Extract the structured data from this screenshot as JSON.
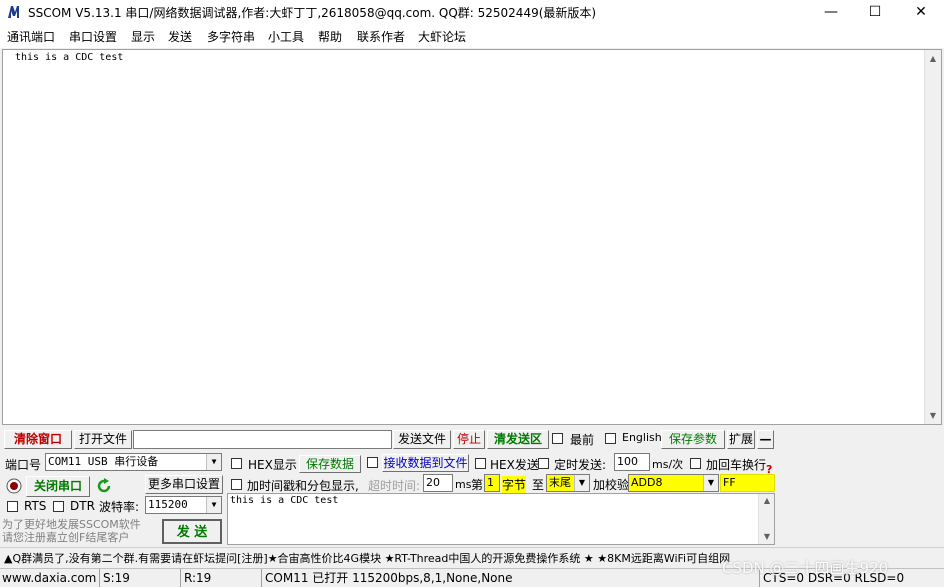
{
  "title": "SSCOM V5.13.1 串口/网络数据调试器,作者:大虾丁丁,2618058@qq.com. QQ群: 52502449(最新版本)",
  "window": {
    "minimize": "—",
    "maximize": "☐",
    "close": "✕"
  },
  "menu": [
    "通讯端口",
    "串口设置",
    "显示",
    "发送",
    "多字符串",
    "小工具",
    "帮助",
    "联系作者",
    "大虾论坛"
  ],
  "receive": {
    "text": "this is a CDC test"
  },
  "toolbar": {
    "clear_window": "清除窗口",
    "open_file": "打开文件",
    "file_path": "",
    "send_file": "发送文件",
    "stop": "停止",
    "clear_send": "清发送区",
    "topmost": "最前",
    "english": "English",
    "save_params": "保存参数",
    "expand": "扩展",
    "collapse": "—"
  },
  "port": {
    "label": "端口号",
    "value": "COM11 USB 串行设备",
    "close_port": "关闭串口",
    "more_settings": "更多串口设置",
    "rts": "RTS",
    "dtr": "DTR",
    "baud_label": "波特率:",
    "baud_value": "115200"
  },
  "options": {
    "hex_display": "HEX显示",
    "save_data": "保存数据",
    "recv_to_file": "接收数据到文件",
    "hex_send": "HEX发送",
    "timed_send": "定时发送:",
    "interval": "100",
    "interval_unit": "ms/次",
    "add_crlf": "加回车换行",
    "timestamp": "加时间戳和分包显示,",
    "timeout_label": "超时时间:",
    "timeout_value": "20",
    "timeout_unit": "ms",
    "nth_label": "第",
    "nth_value": "1",
    "byte_label": "字节",
    "to_label": "至",
    "end_value": "末尾",
    "checksum_label": "加校验",
    "checksum_value": "ADD8",
    "checksum_result": "FF",
    "help_mark": "?"
  },
  "send": {
    "text": "this is a CDC test",
    "button": "发 送",
    "promo": "为了更好地发展SSCOM软件\n请您注册嘉立创F结尾客户"
  },
  "ticker": "▲Q群满员了,没有第二个群.有需要请在虾坛提问[注册]★合宙高性价比4G模块 ★RT-Thread中国人的开源免费操作系统 ★ ★8KM远距离WiFi可自组网",
  "status": {
    "website": "www.daxia.com",
    "sent": "S:19",
    "received": "R:19",
    "port_status": "COM11 已打开  115200bps,8,1,None,None",
    "lines": "CTS=0 DSR=0 RLSD=0"
  },
  "watermark": "CSDN @二十四画生920",
  "colors": {
    "accent_red": "#c00000",
    "accent_green": "#007a00",
    "highlight_yellow": "#ffff00"
  }
}
